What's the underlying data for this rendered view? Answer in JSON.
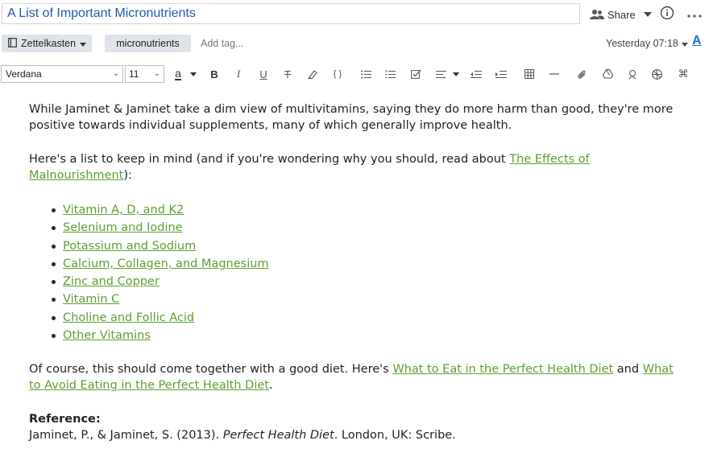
{
  "note": {
    "title": "A List of Important Micronutrients"
  },
  "header": {
    "share_label": "Share"
  },
  "tags": {
    "notebook": "Zettelkasten",
    "items": [
      "micronutrients"
    ],
    "add_placeholder": "Add tag..."
  },
  "meta": {
    "timestamp": "Yesterday 07:18"
  },
  "toolbar": {
    "font_family": "Verdana",
    "font_size": "11",
    "text_color_glyph": "a",
    "bold": "B",
    "italic": "I",
    "underline": "U",
    "strike": "T",
    "code": "{ }",
    "command": "⌘"
  },
  "content": {
    "p1": "While Jaminet & Jaminet take a dim view of multivitamins, saying they do more harm than good, they're more positive towards individual supplements, many of which generally improve health.",
    "p2_text": "Here's a list to keep in mind (and if you're wondering why you should, read about ",
    "p2_link": "The Effects of Malnourishment",
    "p2_end": "):",
    "list": [
      "Vitamin A, D, and K2",
      "Selenium and Iodine",
      "Potassium and Sodium",
      "Calcium, Collagen, and Magnesium",
      "Zinc and Copper",
      "Vitamin C",
      "Choline and Follic Acid",
      "Other Vitamins"
    ],
    "p3_text": "Of course, this should come together with a good diet. Here's ",
    "p3_link1": "What to Eat in the Perfect Health Diet",
    "p3_mid": " and ",
    "p3_link2": "What to Avoid Eating in the Perfect Health Diet",
    "p3_end": ".",
    "reference_heading": "Reference:",
    "reference_pre": "Jaminet, P., & Jaminet, S. (2013). ",
    "reference_title": "Perfect Health Diet",
    "reference_post": ". London, UK: Scribe."
  },
  "colors": {
    "title_blue": "#1a5fa8",
    "link_green": "#5e9e34",
    "chip_bg": "#dfe4ea",
    "accent_blue": "#1f6fd0"
  }
}
